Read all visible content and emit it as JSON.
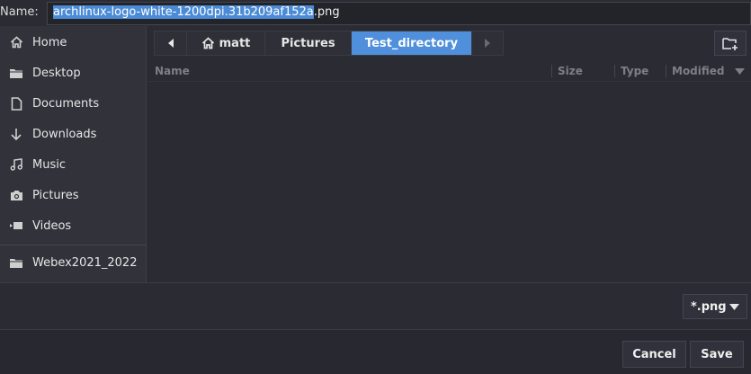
{
  "name_row": {
    "label": "Name:",
    "value_selected": "archlinux-logo-white-1200dpi.31b209af152a",
    "value_rest": ".png"
  },
  "sidebar": {
    "items": [
      {
        "label": "Home",
        "icon": "home-icon"
      },
      {
        "label": "Desktop",
        "icon": "folder-icon"
      },
      {
        "label": "Documents",
        "icon": "document-icon"
      },
      {
        "label": "Downloads",
        "icon": "download-icon"
      },
      {
        "label": "Music",
        "icon": "music-icon"
      },
      {
        "label": "Pictures",
        "icon": "camera-icon"
      },
      {
        "label": "Videos",
        "icon": "video-icon"
      },
      {
        "label": "Webex2021_2022",
        "icon": "folder-icon"
      }
    ]
  },
  "pathbar": {
    "items": [
      "matt",
      "Pictures",
      "Test_directory"
    ]
  },
  "filelist": {
    "columns": [
      "Name",
      "Size",
      "Type",
      "Modified"
    ]
  },
  "filter": {
    "selected": "*.png"
  },
  "actions": {
    "cancel_label": "Cancel",
    "save_label": "Save"
  },
  "colors": {
    "accent": "#4f8fdb",
    "background": "#2b2c33",
    "sidebar": "#31323a"
  }
}
